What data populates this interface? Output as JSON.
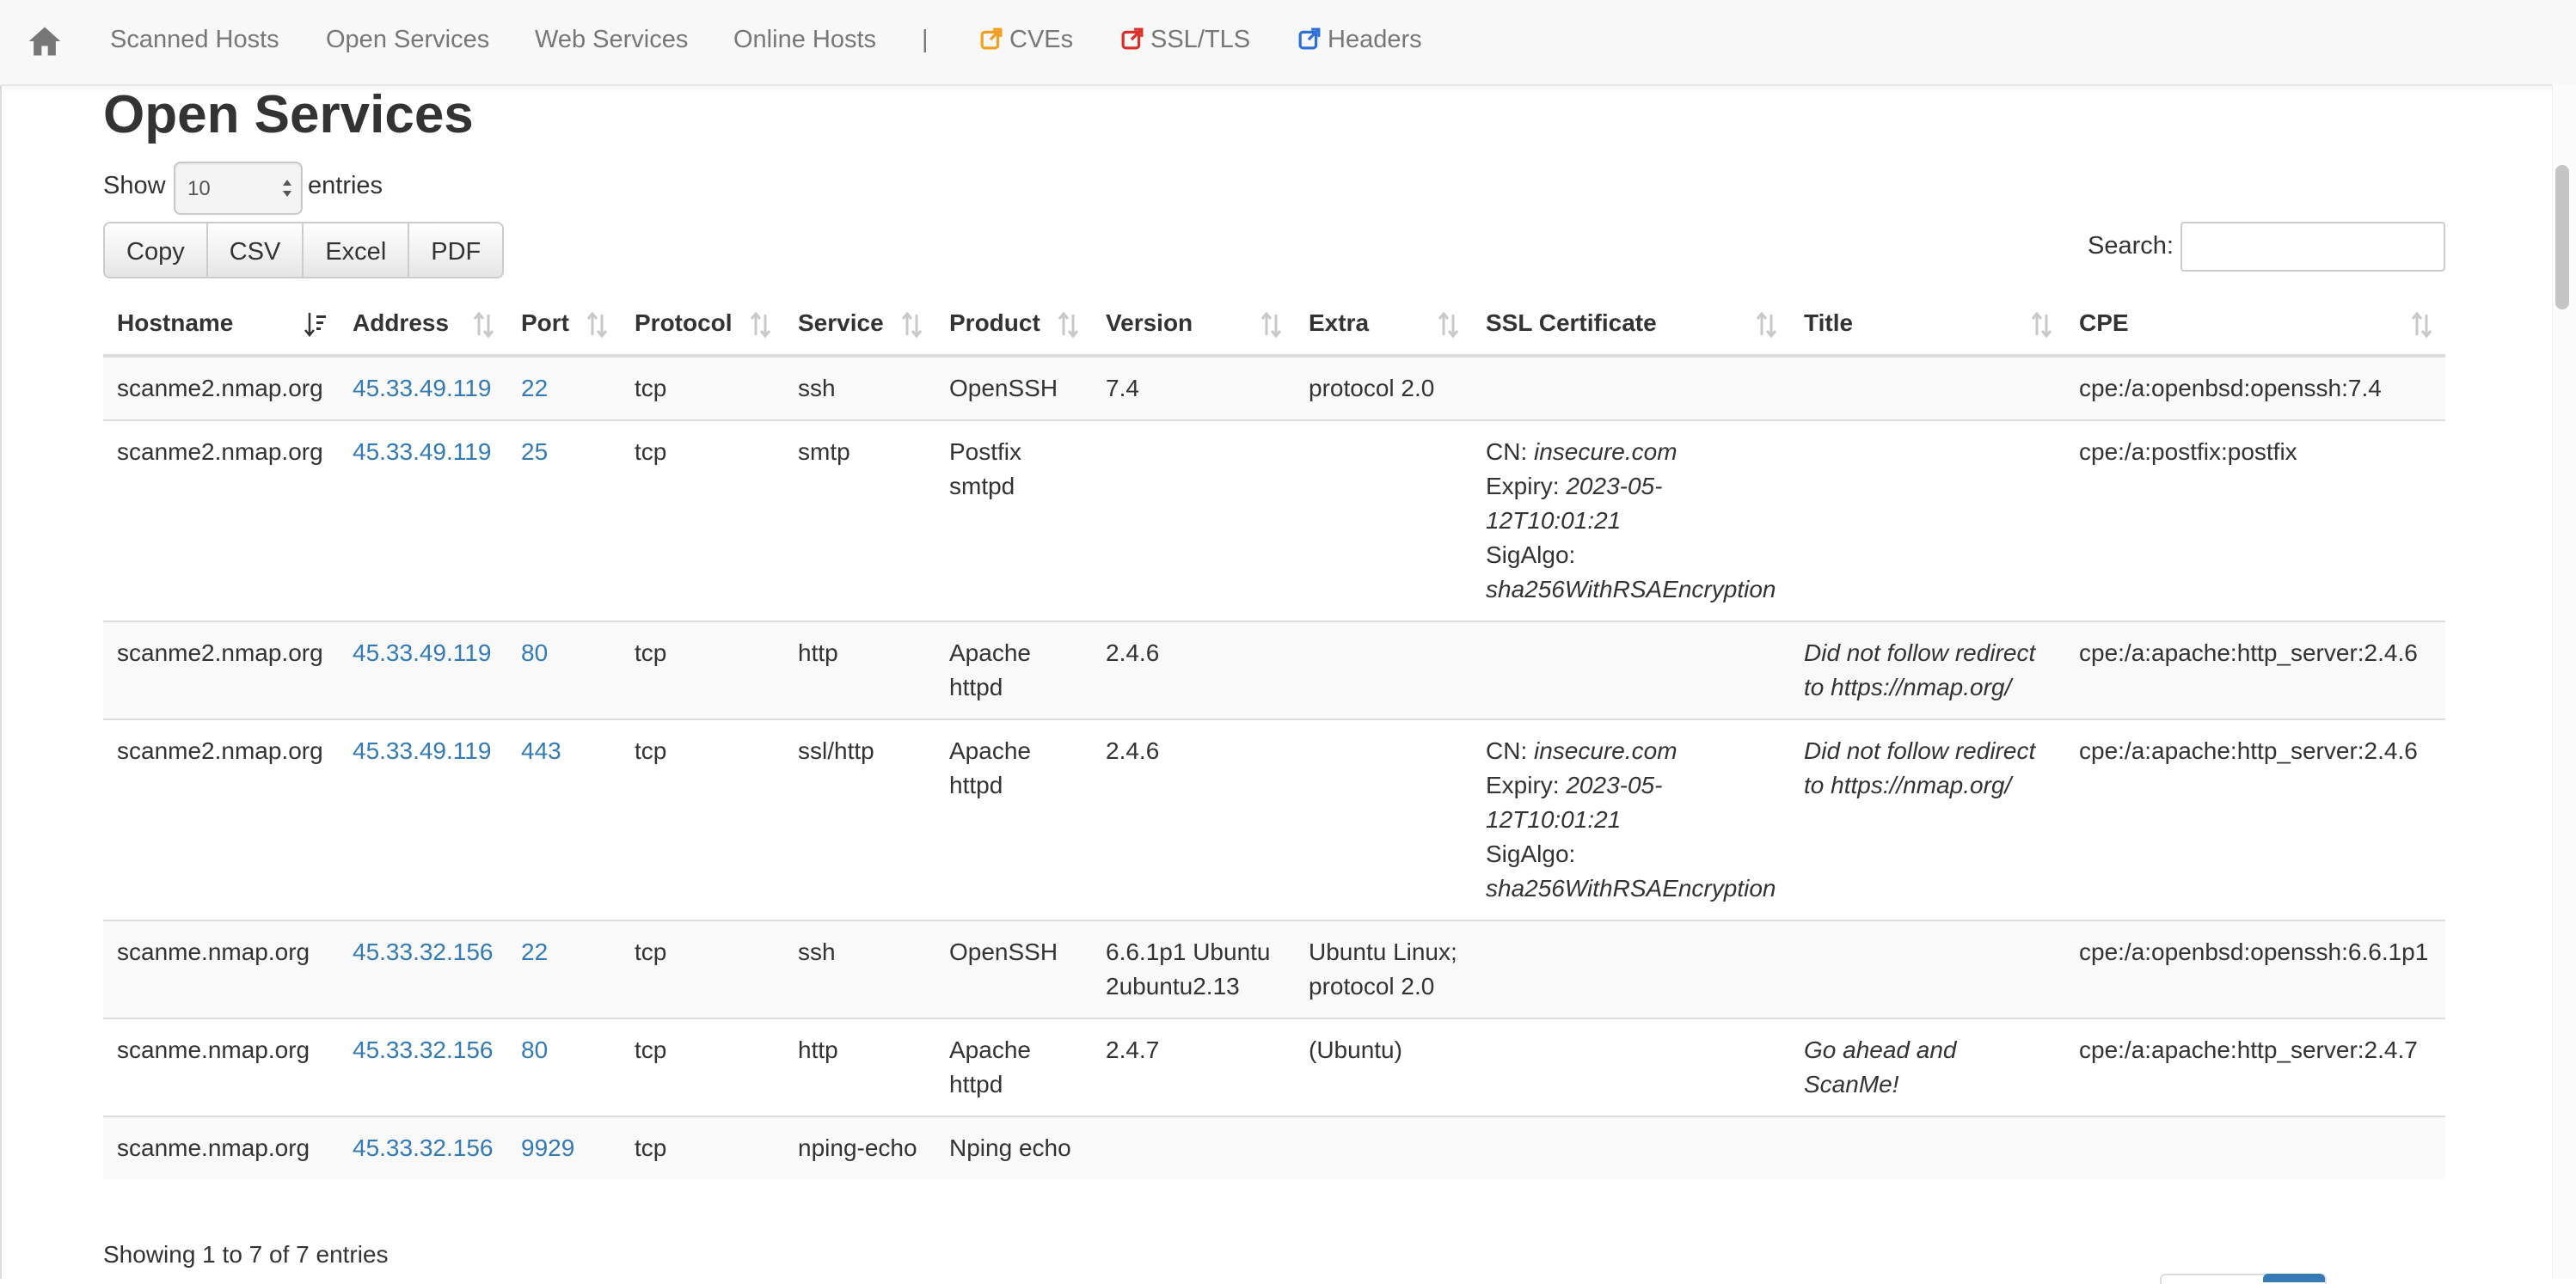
{
  "nav": {
    "items": [
      {
        "label": "Scanned Hosts"
      },
      {
        "label": "Open Services"
      },
      {
        "label": "Web Services"
      },
      {
        "label": "Online Hosts"
      }
    ],
    "separator": "|",
    "links": [
      {
        "label": "CVEs",
        "icon": "external-link-icon",
        "color": "#f0a020"
      },
      {
        "label": "SSL/TLS",
        "icon": "external-link-icon",
        "color": "#d9302c"
      },
      {
        "label": "Headers",
        "icon": "external-link-icon",
        "color": "#2f6fd6"
      }
    ]
  },
  "page": {
    "title": "Open Services"
  },
  "length_menu": {
    "show_label": "Show",
    "value": "10",
    "entries_label": "entries"
  },
  "export_buttons": [
    "Copy",
    "CSV",
    "Excel",
    "PDF"
  ],
  "search": {
    "label": "Search:",
    "value": ""
  },
  "table": {
    "columns": [
      "Hostname",
      "Address",
      "Port",
      "Protocol",
      "Service",
      "Product",
      "Version",
      "Extra",
      "SSL Certificate",
      "Title",
      "CPE"
    ],
    "rows": [
      {
        "hostname": "scanme2.nmap.org",
        "address": "45.33.49.119",
        "port": "22",
        "protocol": "tcp",
        "service": "ssh",
        "product": "OpenSSH",
        "version": "7.4",
        "extra": "protocol 2.0",
        "ssl": null,
        "title": "",
        "cpe": "cpe:/a:openbsd:openssh:7.4"
      },
      {
        "hostname": "scanme2.nmap.org",
        "address": "45.33.49.119",
        "port": "25",
        "protocol": "tcp",
        "service": "smtp",
        "product": "Postfix smtpd",
        "version": "",
        "extra": "",
        "ssl": {
          "cn_label": "CN:",
          "cn": "insecure.com",
          "expiry_label": "Expiry:",
          "expiry": "2023-05-12T10:01:21",
          "sigalgo_label": "SigAlgo:",
          "sigalgo": "sha256WithRSAEncryption"
        },
        "title": "",
        "cpe": "cpe:/a:postfix:postfix"
      },
      {
        "hostname": "scanme2.nmap.org",
        "address": "45.33.49.119",
        "port": "80",
        "protocol": "tcp",
        "service": "http",
        "product": "Apache httpd",
        "version": "2.4.6",
        "extra": "",
        "ssl": null,
        "title": "Did not follow redirect to https://nmap.org/",
        "cpe": "cpe:/a:apache:http_server:2.4.6"
      },
      {
        "hostname": "scanme2.nmap.org",
        "address": "45.33.49.119",
        "port": "443",
        "protocol": "tcp",
        "service": "ssl/http",
        "product": "Apache httpd",
        "version": "2.4.6",
        "extra": "",
        "ssl": {
          "cn_label": "CN:",
          "cn": "insecure.com",
          "expiry_label": "Expiry:",
          "expiry": "2023-05-12T10:01:21",
          "sigalgo_label": "SigAlgo:",
          "sigalgo": "sha256WithRSAEncryption"
        },
        "title": "Did not follow redirect to https://nmap.org/",
        "cpe": "cpe:/a:apache:http_server:2.4.6"
      },
      {
        "hostname": "scanme.nmap.org",
        "address": "45.33.32.156",
        "port": "22",
        "protocol": "tcp",
        "service": "ssh",
        "product": "OpenSSH",
        "version": "6.6.1p1 Ubuntu 2ubuntu2.13",
        "extra": "Ubuntu Linux; protocol 2.0",
        "ssl": null,
        "title": "",
        "cpe": "cpe:/a:openbsd:openssh:6.6.1p1"
      },
      {
        "hostname": "scanme.nmap.org",
        "address": "45.33.32.156",
        "port": "80",
        "protocol": "tcp",
        "service": "http",
        "product": "Apache httpd",
        "version": "2.4.7",
        "extra": "(Ubuntu)",
        "ssl": null,
        "title": "Go ahead and ScanMe!",
        "cpe": "cpe:/a:apache:http_server:2.4.7"
      },
      {
        "hostname": "scanme.nmap.org",
        "address": "45.33.32.156",
        "port": "9929",
        "protocol": "tcp",
        "service": "nping-echo",
        "product": "Nping echo",
        "version": "",
        "extra": "",
        "ssl": null,
        "title": "",
        "cpe": ""
      }
    ]
  },
  "info": "Showing 1 to 7 of 7 entries",
  "colors": {
    "link": "#337ab7",
    "nav_text": "#777777",
    "stripe": "#f9f9f9"
  }
}
